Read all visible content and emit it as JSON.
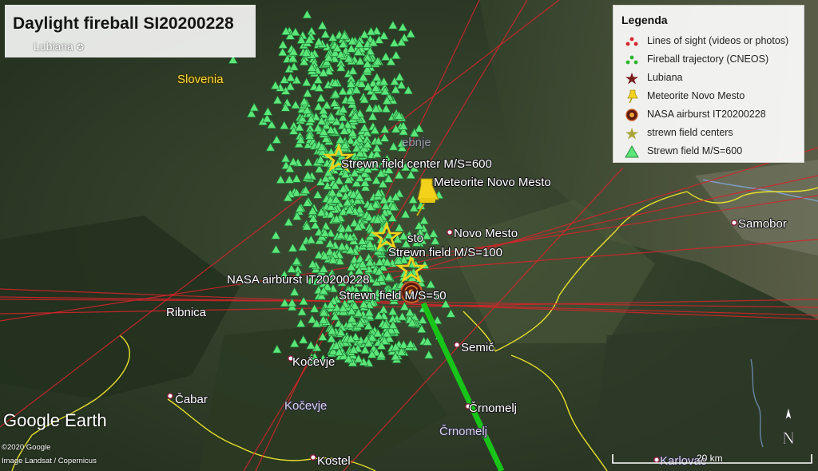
{
  "title": "Daylight fireball SI20200228",
  "legend": {
    "title": "Legenda",
    "items": [
      {
        "label": "Lines of sight (videos or photos)",
        "icon": "red-dots-icon",
        "color": "#d8232a"
      },
      {
        "label": "Fireball trajectory (CNEOS)",
        "icon": "green-dots-icon",
        "color": "#2db52d"
      },
      {
        "label": "Lubiana",
        "icon": "dark-star-icon",
        "color": "#7a1d1d"
      },
      {
        "label": "Meteorite Novo Mesto",
        "icon": "yellow-pushpin-icon",
        "color": "#f2d21b"
      },
      {
        "label": "NASA airburst IT20200228",
        "icon": "red-circle-icon",
        "color": "#b23a1a"
      },
      {
        "label": "strewn field centers",
        "icon": "olive-star-icon",
        "color": "#a8a43a"
      },
      {
        "label": "Strewn field M/S=600",
        "icon": "green-triangle-icon",
        "color": "#5ce67a"
      }
    ]
  },
  "places": {
    "ljubljana": "Lubiana",
    "slovenia": "Slovenia",
    "ribnica": "Ribnica",
    "kocevje": "Kočevje",
    "kocevje_faded": "Kočevje",
    "cabar": "Čabar",
    "novo_mesto": "Novo Mesto",
    "novo_mesto_fragment": "sto",
    "semic": "Semič",
    "crnomelj": "Črnomelj",
    "crnomelj_faded": "Črnomelj",
    "samobor": "Samobor",
    "kostel": "Kostel",
    "karlovac": "Karlovac",
    "trebnje_fragment": "ebnje"
  },
  "annotations": {
    "strewn_600": "Strewn field center M/S=600",
    "meteorite": "Meteorite Novo Mesto",
    "strewn_100": "Strewn field M/S=100",
    "nasa": "NASA airburst IT20200228",
    "strewn_50": "Strewn field M/S=50"
  },
  "branding": {
    "logo": "Google Earth",
    "credit_line1": "©2020 Google",
    "credit_line2": "Image Landsat / Copernicus"
  },
  "compass": "N",
  "scale": "20 km",
  "colors": {
    "lines_of_sight": "#d8232a",
    "trajectory": "#19c419",
    "strewn_triangles": "#5ce67a",
    "borders": "#e8e02a",
    "rivers": "#7fa6d8"
  }
}
